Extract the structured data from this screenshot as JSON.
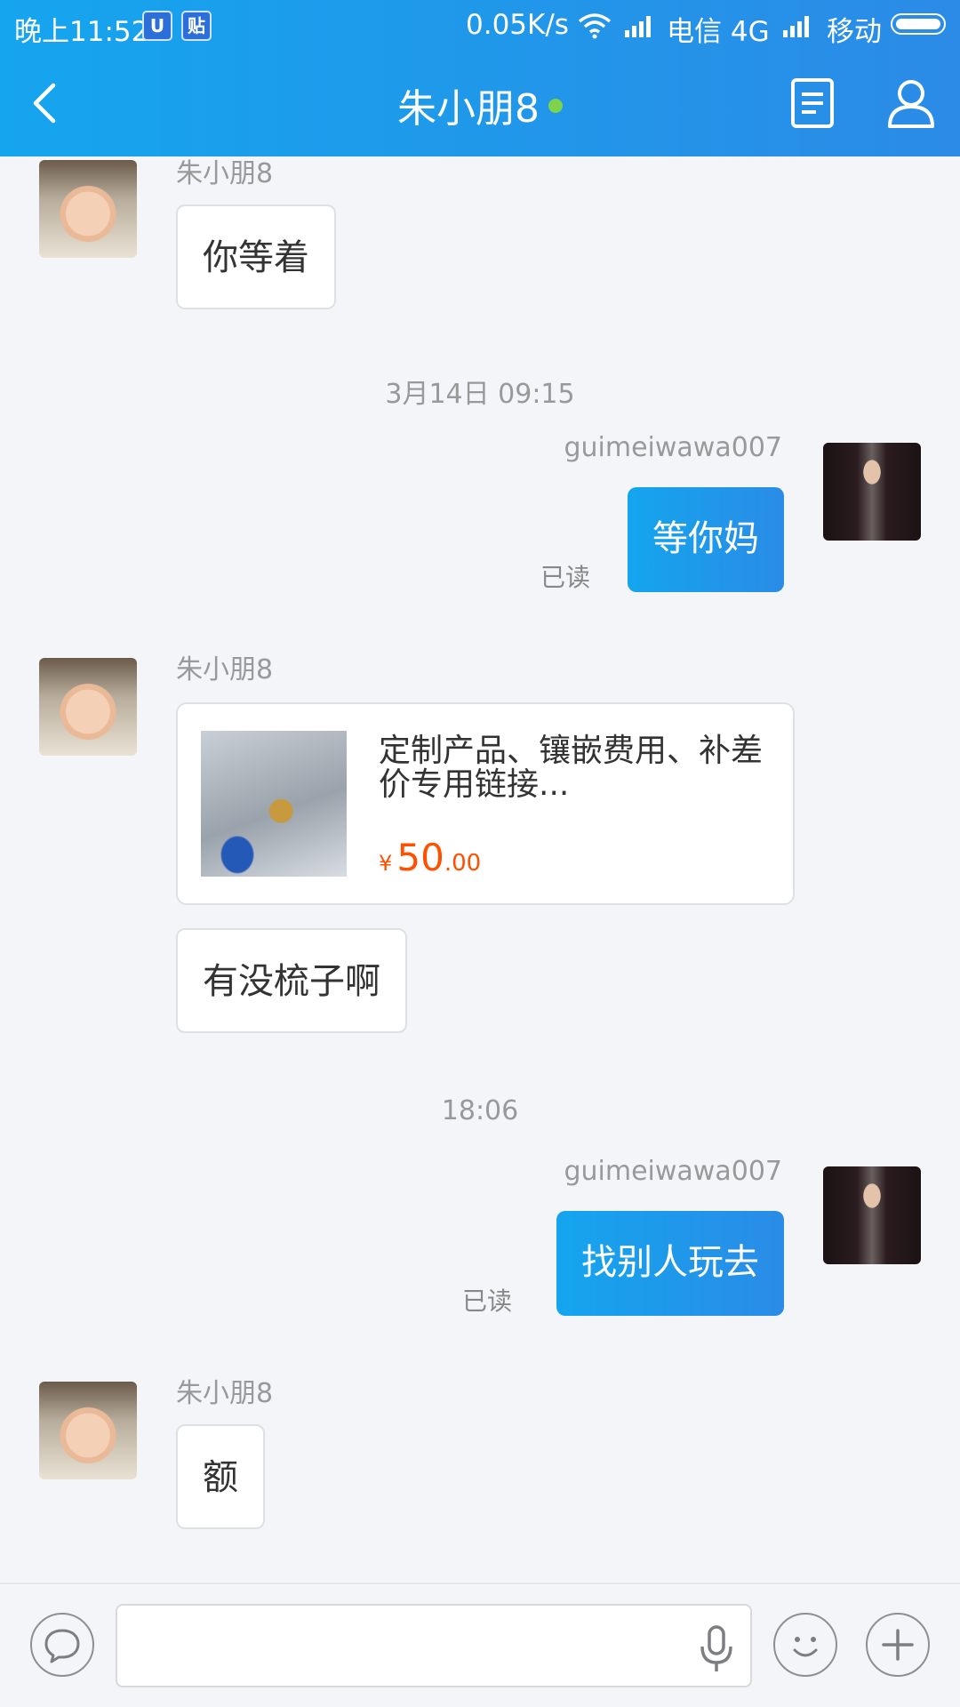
{
  "status_bar": {
    "time": "晚上11:52",
    "app_icon_1": "U",
    "app_icon_2": "贴",
    "net_speed": "0.05K/s",
    "carrier_1": "电信 4G",
    "carrier_2": "移动"
  },
  "header": {
    "title": "朱小朋8",
    "online": true,
    "icons": [
      "back-icon",
      "document-icon",
      "profile-icon"
    ]
  },
  "messages": [
    {
      "side": "in",
      "sender": "朱小朋8",
      "text": "你等着"
    },
    {
      "timestamp": "3月14日 09:15"
    },
    {
      "side": "out",
      "sender": "guimeiwawa007",
      "text": "等你妈",
      "status": "已读"
    },
    {
      "side": "in",
      "sender": "朱小朋8",
      "product": {
        "title": "定制产品、镶嵌费用、补差价专用链接...",
        "currency": "¥",
        "price_int": "50",
        "price_dec": ".00"
      }
    },
    {
      "side": "in",
      "text": "有没梳子啊"
    },
    {
      "timestamp": "18:06"
    },
    {
      "side": "out",
      "sender": "guimeiwawa007",
      "text": "找别人玩去",
      "status": "已读"
    },
    {
      "side": "in",
      "sender": "朱小朋8",
      "text": "额"
    }
  ],
  "input_bar": {
    "icons": [
      "chat-bubble-icon",
      "microphone-icon",
      "emoji-icon",
      "plus-icon"
    ]
  },
  "colors": {
    "header_start": "#15a5ee",
    "header_end": "#2b8be6",
    "online_dot": "#7fd34b",
    "price": "#ff5000",
    "background": "#f4f5f8"
  }
}
